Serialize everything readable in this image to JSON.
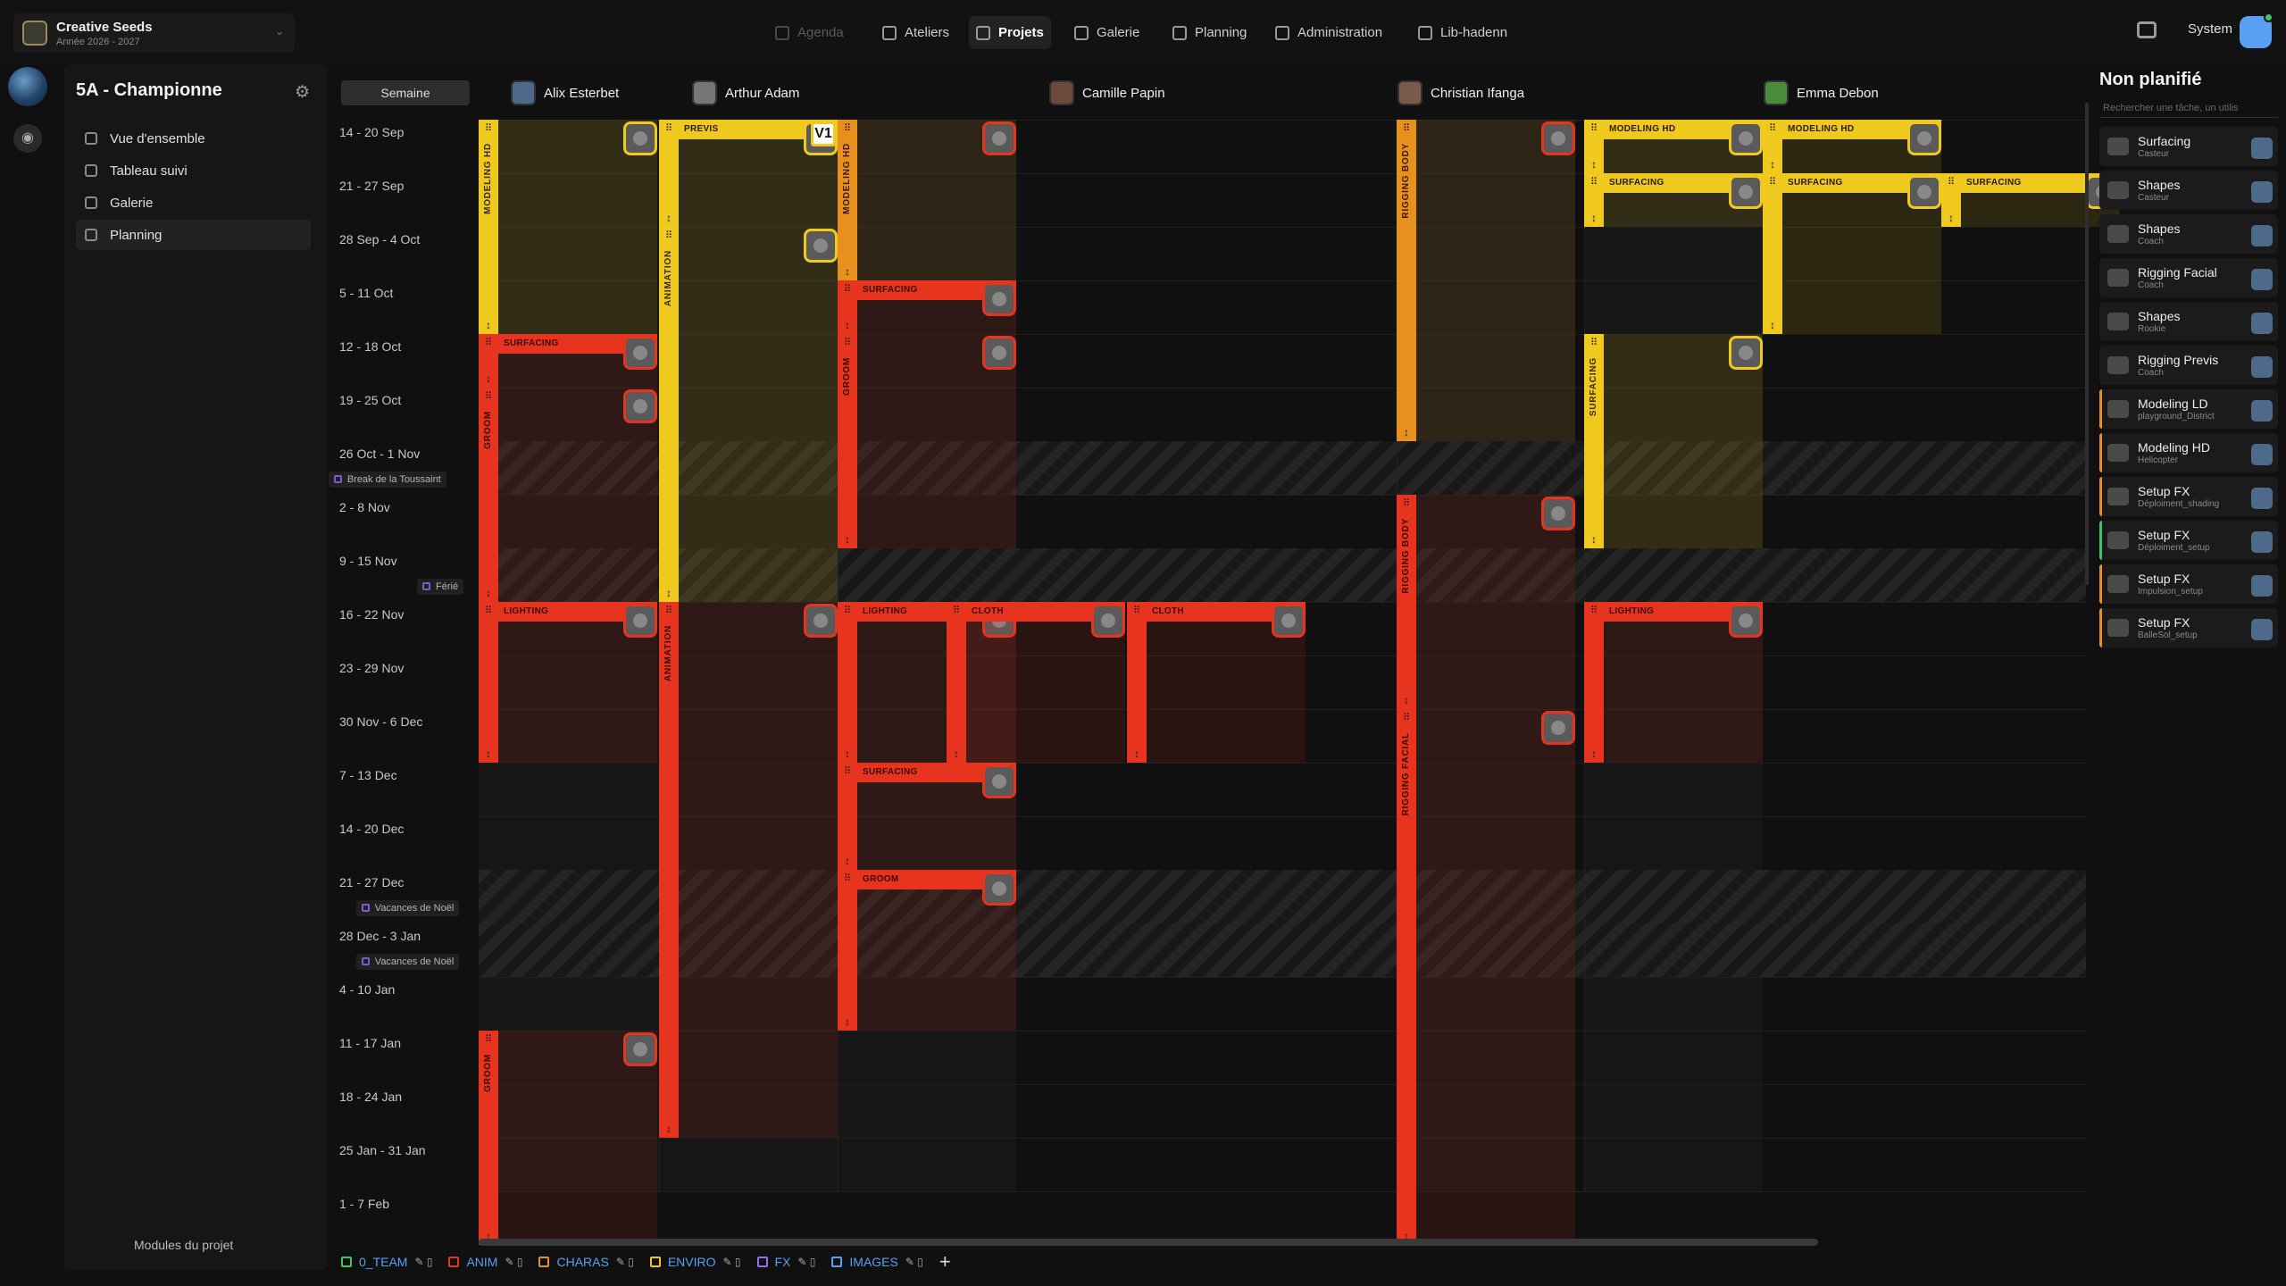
{
  "app": {
    "studio": "Creative Seeds",
    "year": "Année 2026 - 2027",
    "user": "System"
  },
  "nav": [
    {
      "label": "Agenda",
      "icon": "calendar-icon",
      "state": "dim"
    },
    {
      "label": "Ateliers",
      "icon": "workshop-icon",
      "state": "normal"
    },
    {
      "label": "Projets",
      "icon": "projects-icon",
      "state": "active"
    },
    {
      "label": "Galerie",
      "icon": "gallery-icon",
      "state": "normal"
    },
    {
      "label": "Planning",
      "icon": "planning-icon",
      "state": "normal"
    },
    {
      "label": "Administration",
      "icon": "gear-icon",
      "state": "normal"
    },
    {
      "label": "Lib-hadenn",
      "icon": "link-icon",
      "state": "normal"
    }
  ],
  "sidebar": {
    "title": "5A - Championne",
    "items": [
      {
        "label": "Vue d'ensemble",
        "icon": "home-icon"
      },
      {
        "label": "Tableau suivi",
        "icon": "table-icon"
      },
      {
        "label": "Galerie",
        "icon": "gallery-icon"
      },
      {
        "label": "Planning",
        "icon": "planning-icon",
        "active": true
      }
    ],
    "modules": "Modules du projet"
  },
  "planning": {
    "view": "Semaine",
    "people": [
      "Alix Esterbet",
      "Arthur Adam",
      "Camille Papin",
      "Christian Ifanga",
      "Emma Debon"
    ],
    "weeks": [
      "14 - 20 Sep",
      "21 - 27 Sep",
      "28 Sep - 4 Oct",
      "5 - 11 Oct",
      "12 - 18 Oct",
      "19 - 25 Oct",
      "26 Oct - 1 Nov",
      "2 - 8 Nov",
      "9 - 15 Nov",
      "16 - 22 Nov",
      "23 - 29 Nov",
      "30 Nov - 6 Dec",
      "7 - 13 Dec",
      "14 - 20 Dec",
      "21 - 27 Dec",
      "28 Dec - 3 Jan",
      "4 - 10 Jan",
      "11 - 17 Jan",
      "18 - 24 Jan",
      "25 Jan - 31 Jan",
      "1 - 7 Feb"
    ],
    "holidays": [
      {
        "week": 6,
        "label": "Break de la Toussaint"
      },
      {
        "week": 8,
        "label": "Férié"
      },
      {
        "week": 14,
        "label": "Vacances de Noël"
      },
      {
        "week": 15,
        "label": "Vacances de Noël"
      }
    ],
    "version_badge": "V1",
    "tasks": [
      {
        "col": 0,
        "start": 0,
        "span": 4,
        "label": "MODELING HD",
        "color": "yellow",
        "orient": "v"
      },
      {
        "col": 0,
        "start": 4,
        "span": 1,
        "label": "SURFACING",
        "color": "red",
        "orient": "h"
      },
      {
        "col": 0,
        "start": 5,
        "span": 4,
        "label": "GROOM",
        "color": "red",
        "orient": "v"
      },
      {
        "col": 0,
        "start": 9,
        "span": 3,
        "label": "LIGHTING",
        "color": "red",
        "orient": "h"
      },
      {
        "col": 0,
        "start": 17,
        "span": 4,
        "label": "GROOM",
        "color": "red",
        "orient": "v"
      },
      {
        "col": 1,
        "start": 0,
        "span": 2,
        "label": "PREVIS",
        "color": "yellow",
        "orient": "h"
      },
      {
        "col": 1,
        "start": 2,
        "span": 7,
        "label": "ANIMATION",
        "color": "yellow",
        "orient": "v"
      },
      {
        "col": 1,
        "start": 9,
        "span": 10,
        "label": "ANIMATION",
        "color": "red",
        "orient": "v"
      },
      {
        "col": 2,
        "start": 0,
        "span": 3,
        "label": "MODELING HD",
        "color": "orange",
        "orient": "v"
      },
      {
        "col": 2,
        "start": 3,
        "span": 1,
        "label": "SURFACING",
        "color": "red",
        "orient": "h"
      },
      {
        "col": 2,
        "start": 4,
        "span": 4,
        "label": "GROOM",
        "color": "red",
        "orient": "v"
      },
      {
        "col": 2,
        "start": 9,
        "span": 3,
        "label": "LIGHTING",
        "color": "red",
        "orient": "h"
      },
      {
        "col": 2,
        "start": 12,
        "span": 2,
        "label": "SURFACING",
        "color": "red",
        "orient": "h"
      },
      {
        "col": 2,
        "start": 14,
        "span": 3,
        "label": "GROOM",
        "color": "red",
        "orient": "h"
      },
      {
        "col": 3,
        "start": 9,
        "span": 3,
        "label": "CLOTH",
        "color": "red",
        "orient": "h"
      },
      {
        "col": 4,
        "start": 9,
        "span": 3,
        "label": "CLOTH",
        "color": "red",
        "orient": "h"
      },
      {
        "col": 5,
        "start": 0,
        "span": 6,
        "label": "RIGGING BODY",
        "color": "orange",
        "orient": "v"
      },
      {
        "col": 5,
        "start": 7,
        "span": 4,
        "label": "RIGGING BODY",
        "color": "red",
        "orient": "v"
      },
      {
        "col": 5,
        "start": 11,
        "span": 10,
        "label": "RIGGING FACIAL",
        "color": "red",
        "orient": "v"
      },
      {
        "col": 6,
        "start": 0,
        "span": 1,
        "label": "MODELING HD",
        "color": "yellow",
        "orient": "h"
      },
      {
        "col": 6,
        "start": 1,
        "span": 1,
        "label": "SURFACING",
        "color": "yellow",
        "orient": "h"
      },
      {
        "col": 6,
        "start": 4,
        "span": 4,
        "label": "SURFACING",
        "color": "yellow",
        "orient": "v"
      },
      {
        "col": 6,
        "start": 9,
        "span": 3,
        "label": "LIGHTING",
        "color": "red",
        "orient": "h"
      },
      {
        "col": 7,
        "start": 0,
        "span": 1,
        "label": "MODELING HD",
        "color": "yellow",
        "orient": "h"
      },
      {
        "col": 7,
        "start": 1,
        "span": 3,
        "label": "SURFACING",
        "color": "yellow",
        "orient": "h"
      },
      {
        "col": 8,
        "start": 1,
        "span": 1,
        "label": "SURFACING",
        "color": "yellow",
        "orient": "h"
      }
    ],
    "tabs": [
      {
        "label": "0_TEAM",
        "color": "#3ec46d"
      },
      {
        "label": "ANIM",
        "color": "#e6341e"
      },
      {
        "label": "CHARAS",
        "color": "#e8901e"
      },
      {
        "label": "ENVIRO",
        "color": "#f0c91e"
      },
      {
        "label": "FX",
        "color": "#9b6bf0"
      },
      {
        "label": "IMAGES",
        "color": "#5aa0f0"
      }
    ],
    "add_tab": "+"
  },
  "unplanned": {
    "title": "Non planifié",
    "search_placeholder": "Rechercher une tâche, un utilis",
    "items": [
      {
        "name": "Surfacing",
        "sub": "Casteur"
      },
      {
        "name": "Shapes",
        "sub": "Casteur"
      },
      {
        "name": "Shapes",
        "sub": "Coach"
      },
      {
        "name": "Rigging Facial",
        "sub": "Coach"
      },
      {
        "name": "Shapes",
        "sub": "Rookie"
      },
      {
        "name": "Rigging Previs",
        "sub": "Coach"
      },
      {
        "name": "Modeling LD",
        "sub": "playground_District",
        "accent": "#e8901e"
      },
      {
        "name": "Modeling HD",
        "sub": "Helicopter",
        "accent": "#e8901e"
      },
      {
        "name": "Setup FX",
        "sub": "Déploiment_shading",
        "accent": "#e8901e"
      },
      {
        "name": "Setup FX",
        "sub": "Déploiment_setup",
        "accent": "#3ec46d"
      },
      {
        "name": "Setup FX",
        "sub": "Impulsion_setup",
        "accent": "#e8901e"
      },
      {
        "name": "Setup FX",
        "sub": "BalleSol_setup",
        "accent": "#e8901e"
      }
    ]
  },
  "colors": {
    "yellow": "#f0c91e",
    "red": "#e6341e",
    "orange": "#e8901e",
    "accent": "#5aa0f0"
  }
}
